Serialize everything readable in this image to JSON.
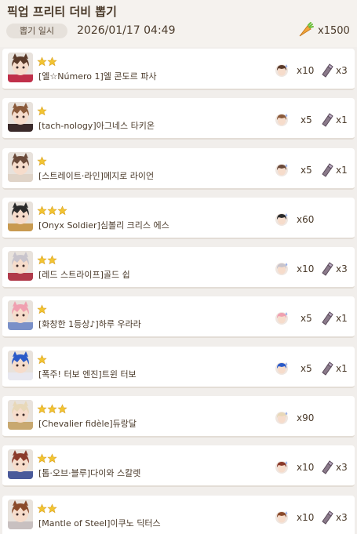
{
  "header": {
    "title": "픽업 프리티 더비 뽑기",
    "date_label": "뽑기 일시",
    "date_value": "2026/01/17 04:49",
    "currency_icon": "carrot-icon",
    "currency_value": "x1500"
  },
  "colors": {
    "star": "#f2c432",
    "background": "#f1eeeb",
    "card": "#ffffff"
  },
  "rows": [
    {
      "stars": 2,
      "name": "[엘☆Número 1]엘 콘도르 파사",
      "qty_a": "x10",
      "qty_b": "x3",
      "hair": "#5a3a2a",
      "accent": "#c0304a"
    },
    {
      "stars": 1,
      "name": "[tach-nology]아그네스 타키온",
      "qty_a": "x5",
      "qty_b": "x1",
      "hair": "#8a5a3a",
      "accent": "#3a2a2a"
    },
    {
      "stars": 1,
      "name": "[스트레이트·라인]메지로 라이언",
      "qty_a": "x5",
      "qty_b": "x1",
      "hair": "#6a4a3a",
      "accent": "#e0d4c8"
    },
    {
      "stars": 3,
      "name": "[Onyx Soldier]심볼리 크리스 에스",
      "qty_a": "x60",
      "qty_b": "",
      "hair": "#2a2a2a",
      "accent": "#c89a50"
    },
    {
      "stars": 2,
      "name": "[레드 스트라이프]골드 쉽",
      "qty_a": "x10",
      "qty_b": "x3",
      "hair": "#c8c4cc",
      "accent": "#b03a4a"
    },
    {
      "stars": 1,
      "name": "[화창한 1등상♪]하루 우라라",
      "qty_a": "x5",
      "qty_b": "x1",
      "hair": "#f0a0b0",
      "accent": "#7a90c8"
    },
    {
      "stars": 1,
      "name": "[폭주! 터보 엔진]트윈 터보",
      "qty_a": "x5",
      "qty_b": "x1",
      "hair": "#2a5ac8",
      "accent": "#e8e8f0"
    },
    {
      "stars": 3,
      "name": "[Chevalier fidèle]듀랑달",
      "qty_a": "x90",
      "qty_b": "",
      "hair": "#e8d8b8",
      "accent": "#c8a870"
    },
    {
      "stars": 2,
      "name": "[톱·오브·블루]다이와 스칼렛",
      "qty_a": "x10",
      "qty_b": "x3",
      "hair": "#8a3a2a",
      "accent": "#4a5a9a"
    },
    {
      "stars": 2,
      "name": "[Mantle of Steel]이쿠노 딕터스",
      "qty_a": "x10",
      "qty_b": "x3",
      "hair": "#8a4a2a",
      "accent": "#c8c0c0"
    }
  ]
}
